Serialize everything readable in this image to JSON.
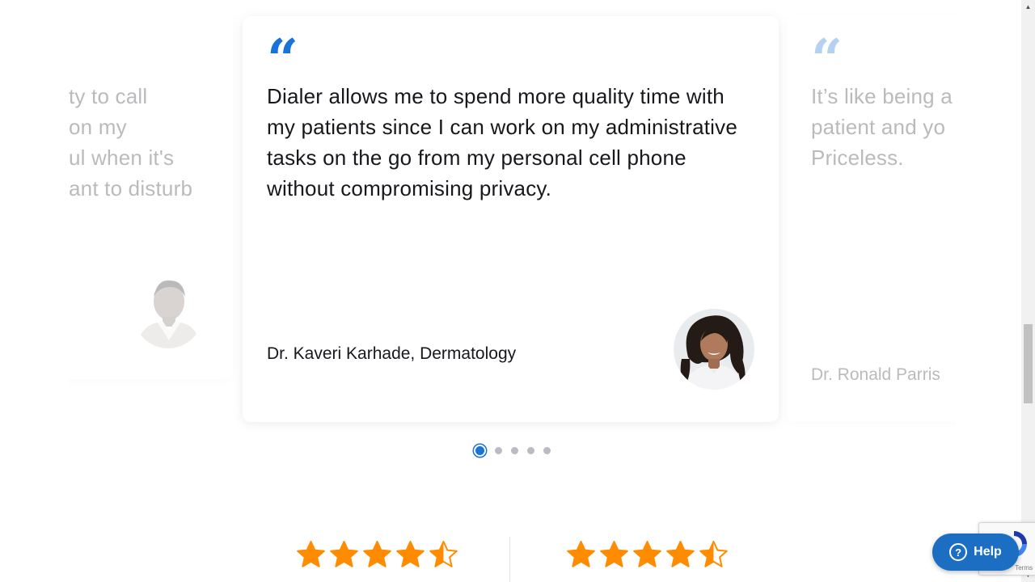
{
  "testimonials": {
    "left": {
      "quote_lines": [
        "ty to call",
        "on my",
        "ul when it's",
        "ant to disturb"
      ]
    },
    "center": {
      "quote_mark": "“",
      "quote": "Dialer allows me to spend more quality time with my patients since I can work on my administrative tasks on the go from my personal cell phone without compromising privacy.",
      "author": "Dr. Kaveri Karhade, Dermatology"
    },
    "right": {
      "quote_mark": "“",
      "quote_lines": [
        "It’s like being a",
        "patient and yo",
        "Priceless."
      ],
      "author": "Dr. Ronald Parris"
    }
  },
  "pagination": {
    "count": 5,
    "active_index": 0
  },
  "ratings": [
    {
      "value": 4.5,
      "max": 5
    },
    {
      "value": 4.5,
      "max": 5
    }
  ],
  "help": {
    "label": "Help",
    "icon": "question-circle-icon"
  },
  "recaptcha": {
    "terms": "Terms"
  },
  "colors": {
    "accent": "#1a73d8",
    "star": "#ff8c00",
    "help_bg": "#1b6ec2"
  }
}
